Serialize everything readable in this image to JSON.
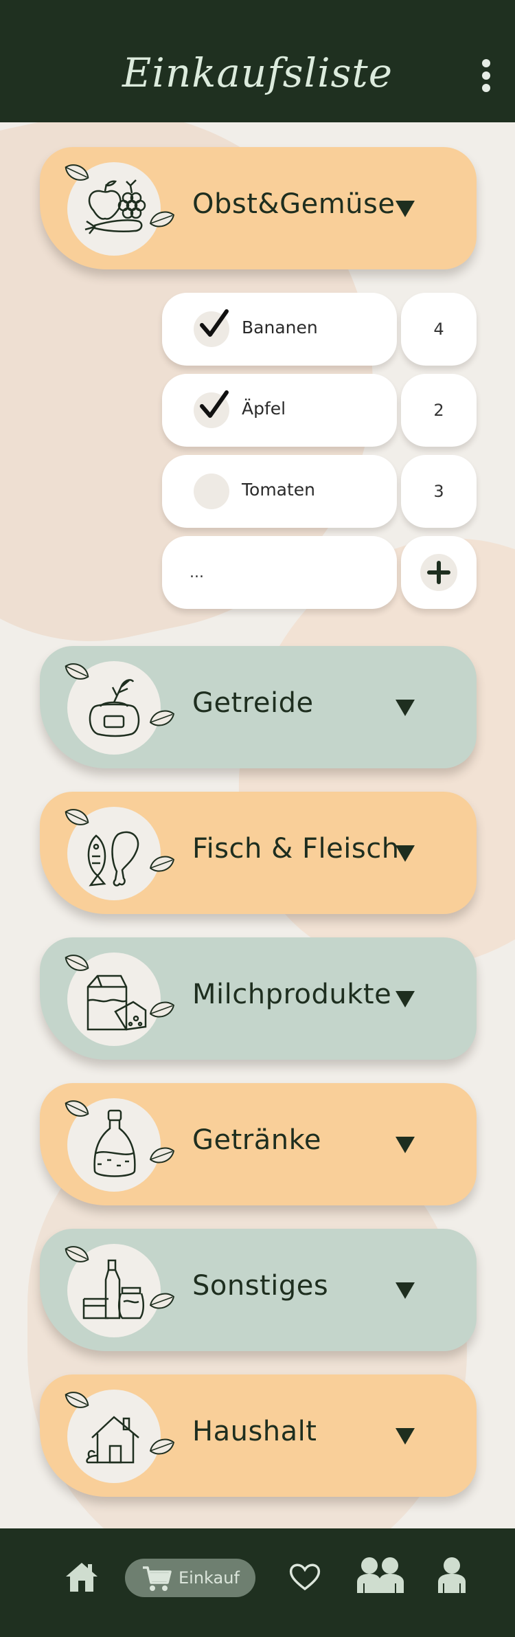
{
  "app": {
    "title": "Einkaufsliste"
  },
  "colors": {
    "header": "#1F3020",
    "orange": "#F9CF99",
    "green": "#C4D5CB",
    "background": "#F1EEE9"
  },
  "categories": [
    {
      "label": "Obst&Gemüse",
      "icon": "fruit-vegetable-icon",
      "expanded": true
    },
    {
      "label": "Getreide",
      "icon": "grain-sack-icon",
      "expanded": false
    },
    {
      "label": "Fisch & Fleisch",
      "icon": "fish-meat-icon",
      "expanded": false
    },
    {
      "label": "Milchprodukte",
      "icon": "milk-cheese-icon",
      "expanded": false
    },
    {
      "label": "Getränke",
      "icon": "bottle-icon",
      "expanded": false
    },
    {
      "label": "Sonstiges",
      "icon": "jars-icon",
      "expanded": false
    },
    {
      "label": "Haushalt",
      "icon": "house-icon",
      "expanded": false
    }
  ],
  "items": [
    {
      "name": "Bananen",
      "quantity": "4",
      "checked": true
    },
    {
      "name": "Äpfel",
      "quantity": "2",
      "checked": true
    },
    {
      "name": "Tomaten",
      "quantity": "3",
      "checked": false
    }
  ],
  "new_item": {
    "placeholder": "..."
  },
  "nav": {
    "home": "home-icon",
    "cart": {
      "label": "Einkauf",
      "icon": "cart-icon",
      "active": true
    },
    "favorites": "heart-icon",
    "groups": "group-icon",
    "profile": "profile-icon"
  }
}
